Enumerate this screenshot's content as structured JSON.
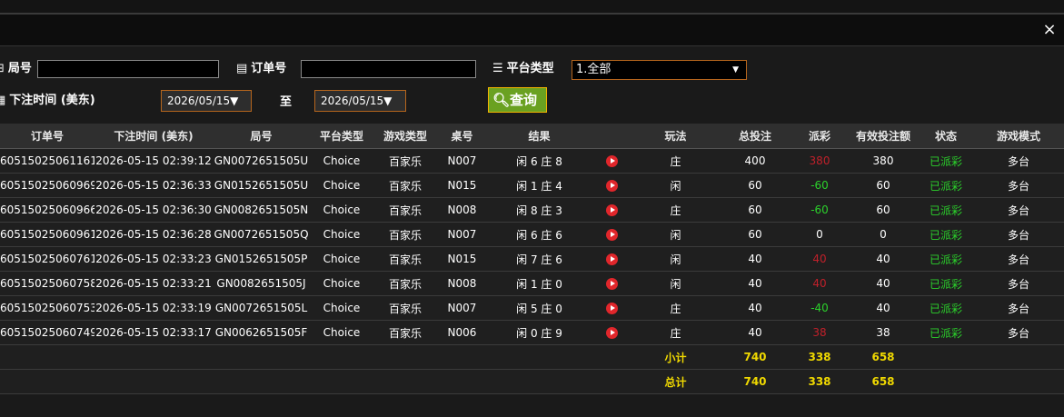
{
  "window": {
    "close_label": "×"
  },
  "filters": {
    "round_label": "局号",
    "order_label": "订单号",
    "platform_label": "平台类型",
    "platform_value": "1.全部",
    "bet_time_label": "下注时间 (美东)",
    "date_from": "2026/05/15▼",
    "to_label": "至",
    "date_to": "2026/05/15▼",
    "search_label": "查询",
    "search_icon": "search-icon"
  },
  "table": {
    "headers": [
      "订单号",
      "下注时间 (美东)",
      "局号",
      "平台类型",
      "游戏类型",
      "桌号",
      "结果",
      "",
      "玩法",
      "总投注",
      "派彩",
      "有效投注额",
      "状态",
      "游戏模式"
    ],
    "rows": [
      {
        "order": "60515025061161",
        "time": "2026-05-15 02:39:12",
        "round": "GN0072651505U",
        "platform": "Choice",
        "game": "百家乐",
        "table": "N007",
        "result": "闲 6 庄 8",
        "play": "庄",
        "bet": "400",
        "payout": "380",
        "payout_sign": "pos-red",
        "valid": "380",
        "status": "已派彩",
        "mode": "多台"
      },
      {
        "order": "60515025060969",
        "time": "2026-05-15 02:36:33",
        "round": "GN0152651505U",
        "platform": "Choice",
        "game": "百家乐",
        "table": "N015",
        "result": "闲 1 庄 4",
        "play": "闲",
        "bet": "60",
        "payout": "-60",
        "payout_sign": "neg",
        "valid": "60",
        "status": "已派彩",
        "mode": "多台"
      },
      {
        "order": "60515025060966",
        "time": "2026-05-15 02:36:30",
        "round": "GN0082651505N",
        "platform": "Choice",
        "game": "百家乐",
        "table": "N008",
        "result": "闲 8 庄 3",
        "play": "庄",
        "bet": "60",
        "payout": "-60",
        "payout_sign": "neg",
        "valid": "60",
        "status": "已派彩",
        "mode": "多台"
      },
      {
        "order": "60515025060961",
        "time": "2026-05-15 02:36:28",
        "round": "GN0072651505Q",
        "platform": "Choice",
        "game": "百家乐",
        "table": "N007",
        "result": "闲 6 庄 6",
        "play": "闲",
        "bet": "60",
        "payout": "0",
        "payout_sign": "zero",
        "valid": "0",
        "status": "已派彩",
        "mode": "多台"
      },
      {
        "order": "60515025060761",
        "time": "2026-05-15 02:33:23",
        "round": "GN0152651505P",
        "platform": "Choice",
        "game": "百家乐",
        "table": "N015",
        "result": "闲 7 庄 6",
        "play": "闲",
        "bet": "40",
        "payout": "40",
        "payout_sign": "pos-red",
        "valid": "40",
        "status": "已派彩",
        "mode": "多台"
      },
      {
        "order": "60515025060758",
        "time": "2026-05-15 02:33:21",
        "round": "GN0082651505J",
        "platform": "Choice",
        "game": "百家乐",
        "table": "N008",
        "result": "闲 1 庄 0",
        "play": "闲",
        "bet": "40",
        "payout": "40",
        "payout_sign": "pos-red",
        "valid": "40",
        "status": "已派彩",
        "mode": "多台"
      },
      {
        "order": "60515025060753",
        "time": "2026-05-15 02:33:19",
        "round": "GN0072651505L",
        "platform": "Choice",
        "game": "百家乐",
        "table": "N007",
        "result": "闲 5 庄 0",
        "play": "庄",
        "bet": "40",
        "payout": "-40",
        "payout_sign": "neg",
        "valid": "40",
        "status": "已派彩",
        "mode": "多台"
      },
      {
        "order": "60515025060749",
        "time": "2026-05-15 02:33:17",
        "round": "GN0062651505F",
        "platform": "Choice",
        "game": "百家乐",
        "table": "N006",
        "result": "闲 0 庄 9",
        "play": "庄",
        "bet": "40",
        "payout": "38",
        "payout_sign": "pos-red",
        "valid": "38",
        "status": "已派彩",
        "mode": "多台"
      }
    ],
    "subtotal": {
      "label": "小计",
      "bet": "740",
      "payout": "338",
      "valid": "658"
    },
    "total": {
      "label": "总计",
      "bet": "740",
      "payout": "338",
      "valid": "658"
    }
  },
  "colors": {
    "accent_border": "#b5651d",
    "button_bg": "#6aa121",
    "positive": "#c0202a",
    "negative": "#2bd12b",
    "total_text": "#f0d900"
  }
}
